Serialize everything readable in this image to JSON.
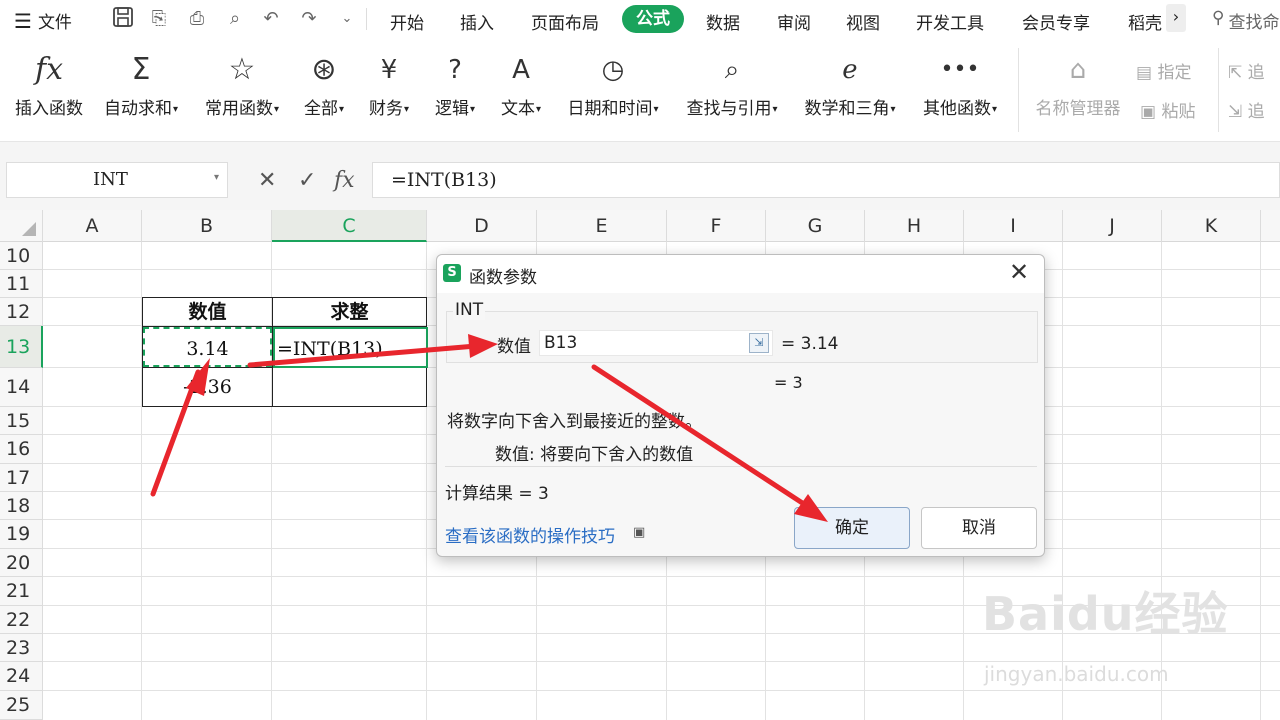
{
  "menu": {
    "file": "文件",
    "tabs": [
      "开始",
      "插入",
      "页面布局",
      "公式",
      "数据",
      "审阅",
      "视图",
      "开发工具",
      "会员专享",
      "稻壳"
    ],
    "active_tab": "公式",
    "search": "查找命",
    "more": "›"
  },
  "ribbon": {
    "items": [
      {
        "icon": "fx-icon",
        "label": "插入函数",
        "dropdown": false
      },
      {
        "icon": "sigma-icon",
        "label": "自动求和",
        "dropdown": true
      },
      {
        "icon": "star-icon",
        "label": "常用函数",
        "dropdown": true
      },
      {
        "icon": "asterisk-icon",
        "label": "全部",
        "dropdown": true
      },
      {
        "icon": "yen-icon",
        "label": "财务",
        "dropdown": true
      },
      {
        "icon": "question-icon",
        "label": "逻辑",
        "dropdown": true
      },
      {
        "icon": "text-a-icon",
        "label": "文本",
        "dropdown": true
      },
      {
        "icon": "clock-icon",
        "label": "日期和时间",
        "dropdown": true
      },
      {
        "icon": "magnifier-icon",
        "label": "查找与引用",
        "dropdown": true
      },
      {
        "icon": "math-e-icon",
        "label": "数学和三角",
        "dropdown": true
      },
      {
        "icon": "dots-icon",
        "label": "其他函数",
        "dropdown": true
      }
    ],
    "name_manager": "名称管理器",
    "specify": "指定",
    "paste": "粘贴",
    "trace1": "追",
    "trace2": "追"
  },
  "formula_bar": {
    "name_box": "INT",
    "formula": "=INT(B13)"
  },
  "grid": {
    "columns": [
      "A",
      "B",
      "C",
      "D",
      "E",
      "F",
      "G",
      "H",
      "I",
      "J",
      "K"
    ],
    "selected_column": "C",
    "rows": [
      "10",
      "11",
      "12",
      "13",
      "14",
      "15",
      "16",
      "17",
      "18",
      "19",
      "20",
      "21",
      "22",
      "23",
      "24",
      "25"
    ],
    "selected_row": "13",
    "table": {
      "header_b": "数值",
      "header_c": "求整",
      "b13": "3.14",
      "c13": "=INT(B13)",
      "b14": "-2.36",
      "c14": ""
    }
  },
  "dialog": {
    "title": "函数参数",
    "function_name": "INT",
    "arg_label": "数值",
    "arg_value": "B13",
    "arg_result": "= 3.14",
    "result_inline": "= 3",
    "description": "将数字向下舍入到最接近的整数。",
    "param_description": "数值:  将要向下舍入的数值",
    "calc_result": "计算结果 = 3",
    "help_link": "查看该函数的操作技巧",
    "ok": "确定",
    "cancel": "取消"
  },
  "watermark": {
    "brand": "Baidu经验",
    "url": "jingyan.baidu.com"
  },
  "colors": {
    "accent": "#1aa35c",
    "arrow": "#e8262d",
    "link": "#2a6dc4"
  }
}
